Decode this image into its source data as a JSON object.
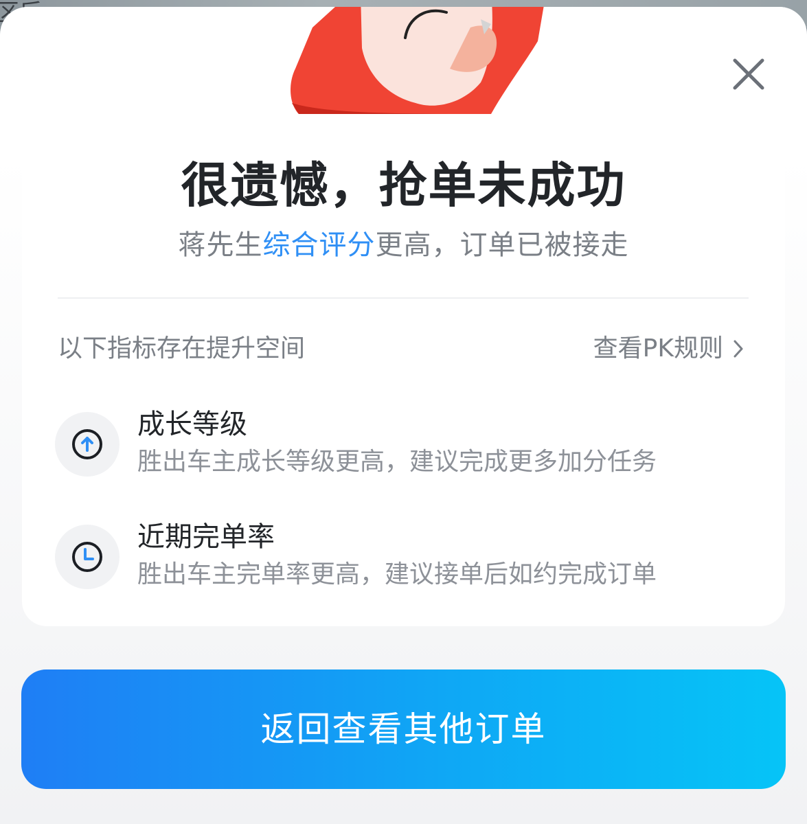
{
  "backdrop": {
    "partial_text": "区后"
  },
  "dialog": {
    "title": "很遗憾，抢单未成功",
    "subtitle_prefix": "蒋先生",
    "subtitle_highlight": "综合评分",
    "subtitle_suffix": "更高，订单已被接走",
    "section_label": "以下指标存在提升空间",
    "pk_rules_link": "查看PK规则",
    "metrics": [
      {
        "icon": "arrow-up-circle-icon",
        "title": "成长等级",
        "description": "胜出车主成长等级更高，建议完成更多加分任务"
      },
      {
        "icon": "clock-icon",
        "title": "近期完单率",
        "description": "胜出车主完单率更高，建议接单后如约完成订单"
      }
    ],
    "primary_button": "返回查看其他订单"
  },
  "colors": {
    "highlight": "#2f8ff5",
    "button_start": "#1f7ef5",
    "button_end": "#06c4f7",
    "illustration_red": "#f04434"
  }
}
